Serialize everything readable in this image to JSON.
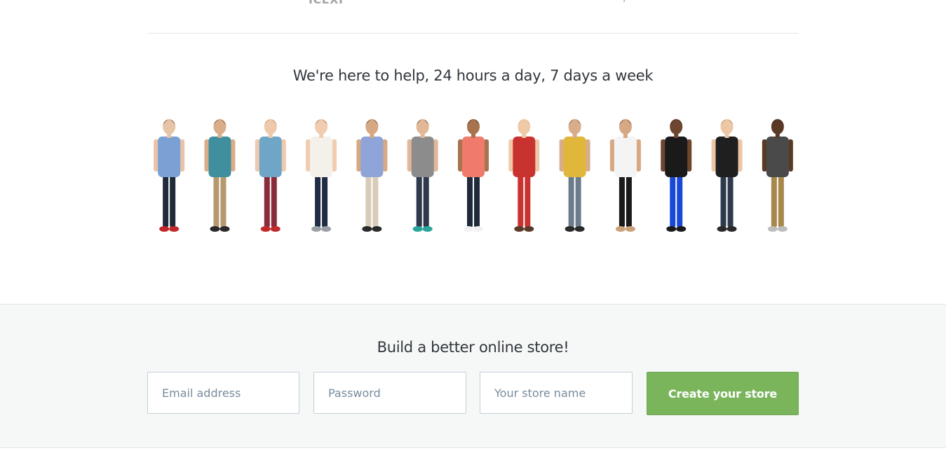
{
  "top": {
    "cutoff_left": "ICEXI",
    "cutoff_right": ","
  },
  "help": {
    "heading": "We're here to help, 24 hours a day, 7 days a week"
  },
  "team": {
    "people": [
      {
        "shirt": "#7aa0d4",
        "pants": "#1f2a3a",
        "shoes": "#c0282b",
        "skin": "#e8c4a6",
        "hair": "#1a1412"
      },
      {
        "shirt": "#3f8f9e",
        "pants": "#b49a6e",
        "shoes": "#2a2a2a",
        "skin": "#d9ad8a",
        "hair": "#3b2a1f"
      },
      {
        "shirt": "#6fa6c8",
        "pants": "#8a2b3c",
        "shoes": "#c0282b",
        "skin": "#efc9ab",
        "hair": "#8a6a3e"
      },
      {
        "shirt": "#f4f1ea",
        "pants": "#1f2d44",
        "shoes": "#9aa0a6",
        "skin": "#f0cdb0",
        "hair": "#6a3b22"
      },
      {
        "shirt": "#8fa4d8",
        "pants": "#d8ccb8",
        "shoes": "#2a2a2a",
        "skin": "#d6a884",
        "hair": "#2a1c14"
      },
      {
        "shirt": "#8c8c8c",
        "pants": "#2e3a4c",
        "shoes": "#2aa59a",
        "skin": "#e2b899",
        "hair": "#2a1c14"
      },
      {
        "shirt": "#f07a6c",
        "pants": "#1f2a3a",
        "shoes": "#f2f2f2",
        "skin": "#a8734f",
        "hair": "#1a1412"
      },
      {
        "shirt": "#c9332f",
        "pants": "#c9332f",
        "shoes": "#5a3a2a",
        "skin": "#f0caa8",
        "hair": "#d8b36a"
      },
      {
        "shirt": "#e0b73a",
        "pants": "#6c7c8c",
        "shoes": "#2a2a2a",
        "skin": "#d9ad8a",
        "hair": "#4a3826"
      },
      {
        "shirt": "#f4f4f4",
        "pants": "#1a1a1a",
        "shoes": "#c9a27a",
        "skin": "#d6a884",
        "hair": "#1a1412"
      },
      {
        "shirt": "#1a1a1a",
        "pants": "#1a49d8",
        "shoes": "#1a1a1a",
        "skin": "#6e4630",
        "hair": "#1a1412"
      },
      {
        "shirt": "#1f1f1f",
        "pants": "#2e3a4c",
        "shoes": "#2a2a2a",
        "skin": "#edc6a6",
        "hair": "#8a6a3e"
      },
      {
        "shirt": "#4a4a4a",
        "pants": "#a8874a",
        "shoes": "#bdbdbd",
        "skin": "#5a3a26",
        "hair": "#1a1412"
      }
    ]
  },
  "signup": {
    "heading": "Build a better online store!",
    "email_placeholder": "Email address",
    "password_placeholder": "Password",
    "store_placeholder": "Your store name",
    "button_label": "Create your store",
    "accent": "#7ab55c"
  }
}
